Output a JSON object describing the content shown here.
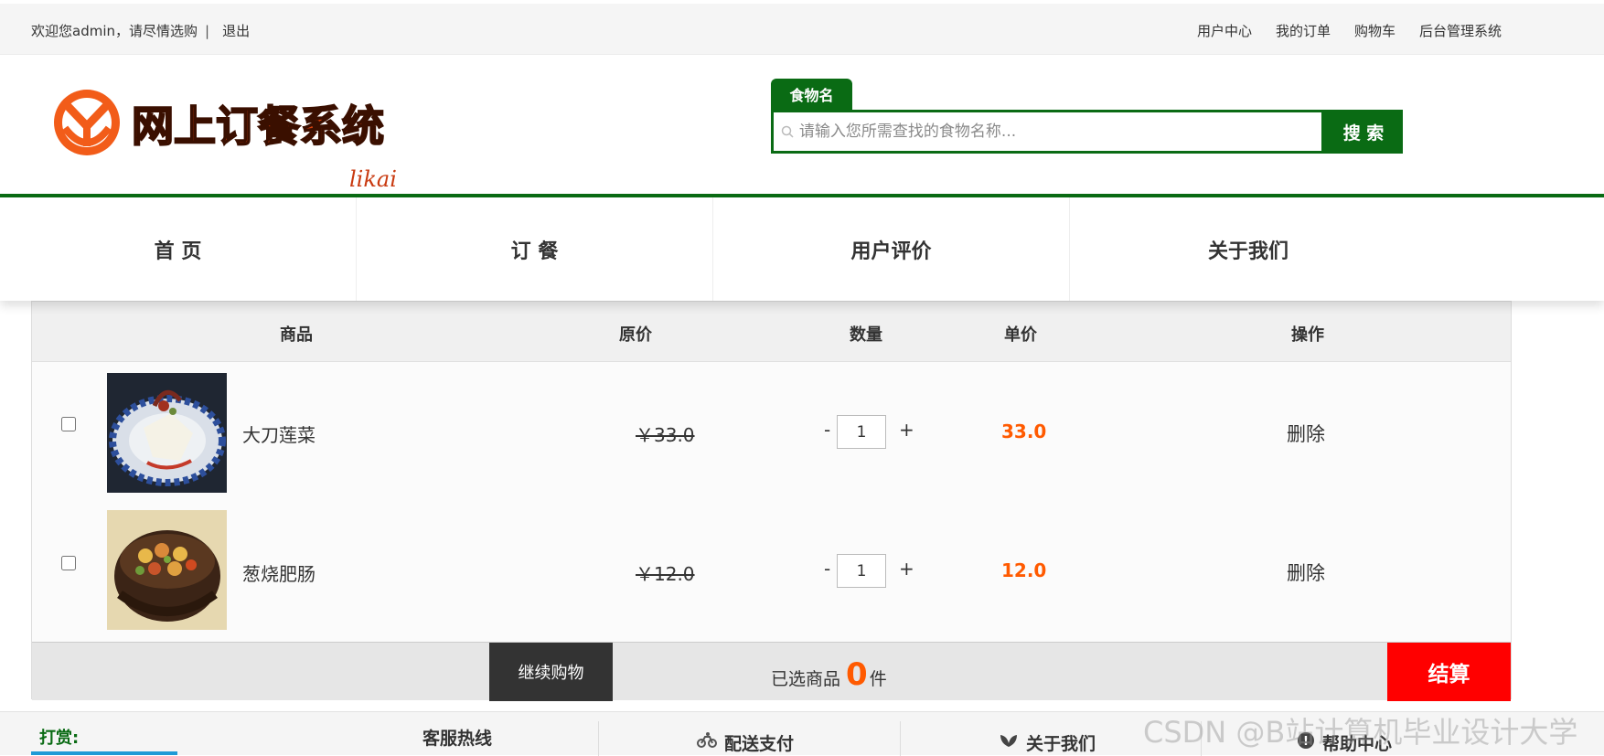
{
  "topbar": {
    "welcome": "欢迎您admin，请尽情选购",
    "separator": "|",
    "logout": "退出",
    "links": [
      "用户中心",
      "我的订单",
      "购物车",
      "后台管理系统"
    ]
  },
  "header": {
    "logo_text": "网上订餐系统",
    "logo_sub": "likai",
    "search_tab": "食物名",
    "search_placeholder": "请输入您所需查找的食物名称...",
    "search_button": "搜 索"
  },
  "nav": [
    "首 页",
    "订 餐",
    "用户评价",
    "关于我们"
  ],
  "cart": {
    "columns": {
      "product": "商品",
      "original_price": "原价",
      "quantity": "数量",
      "unit_price": "单价",
      "action": "操作"
    },
    "items": [
      {
        "name": "大刀莲菜",
        "original_price": "￥33.0",
        "quantity": "1",
        "unit_price": "33.0",
        "delete": "删除",
        "minus": "-",
        "plus": "+"
      },
      {
        "name": "葱烧肥肠",
        "original_price": "￥12.0",
        "quantity": "1",
        "unit_price": "12.0",
        "delete": "删除",
        "minus": "-",
        "plus": "+"
      }
    ],
    "continue_shopping": "继续购物",
    "selected_prefix": "已选商品",
    "selected_count": "0",
    "selected_suffix": "件",
    "checkout": "结算"
  },
  "footer": {
    "tip": "打赏:",
    "hotline": "客服热线",
    "delivery": "配送支付",
    "about": "关于我们",
    "help": "帮助中心"
  },
  "watermark": "CSDN @B站计算机毕业设计大学",
  "colors": {
    "brand_green": "#0a6b14",
    "price_orange": "#ff5a00",
    "checkout_red": "#ff0000"
  }
}
